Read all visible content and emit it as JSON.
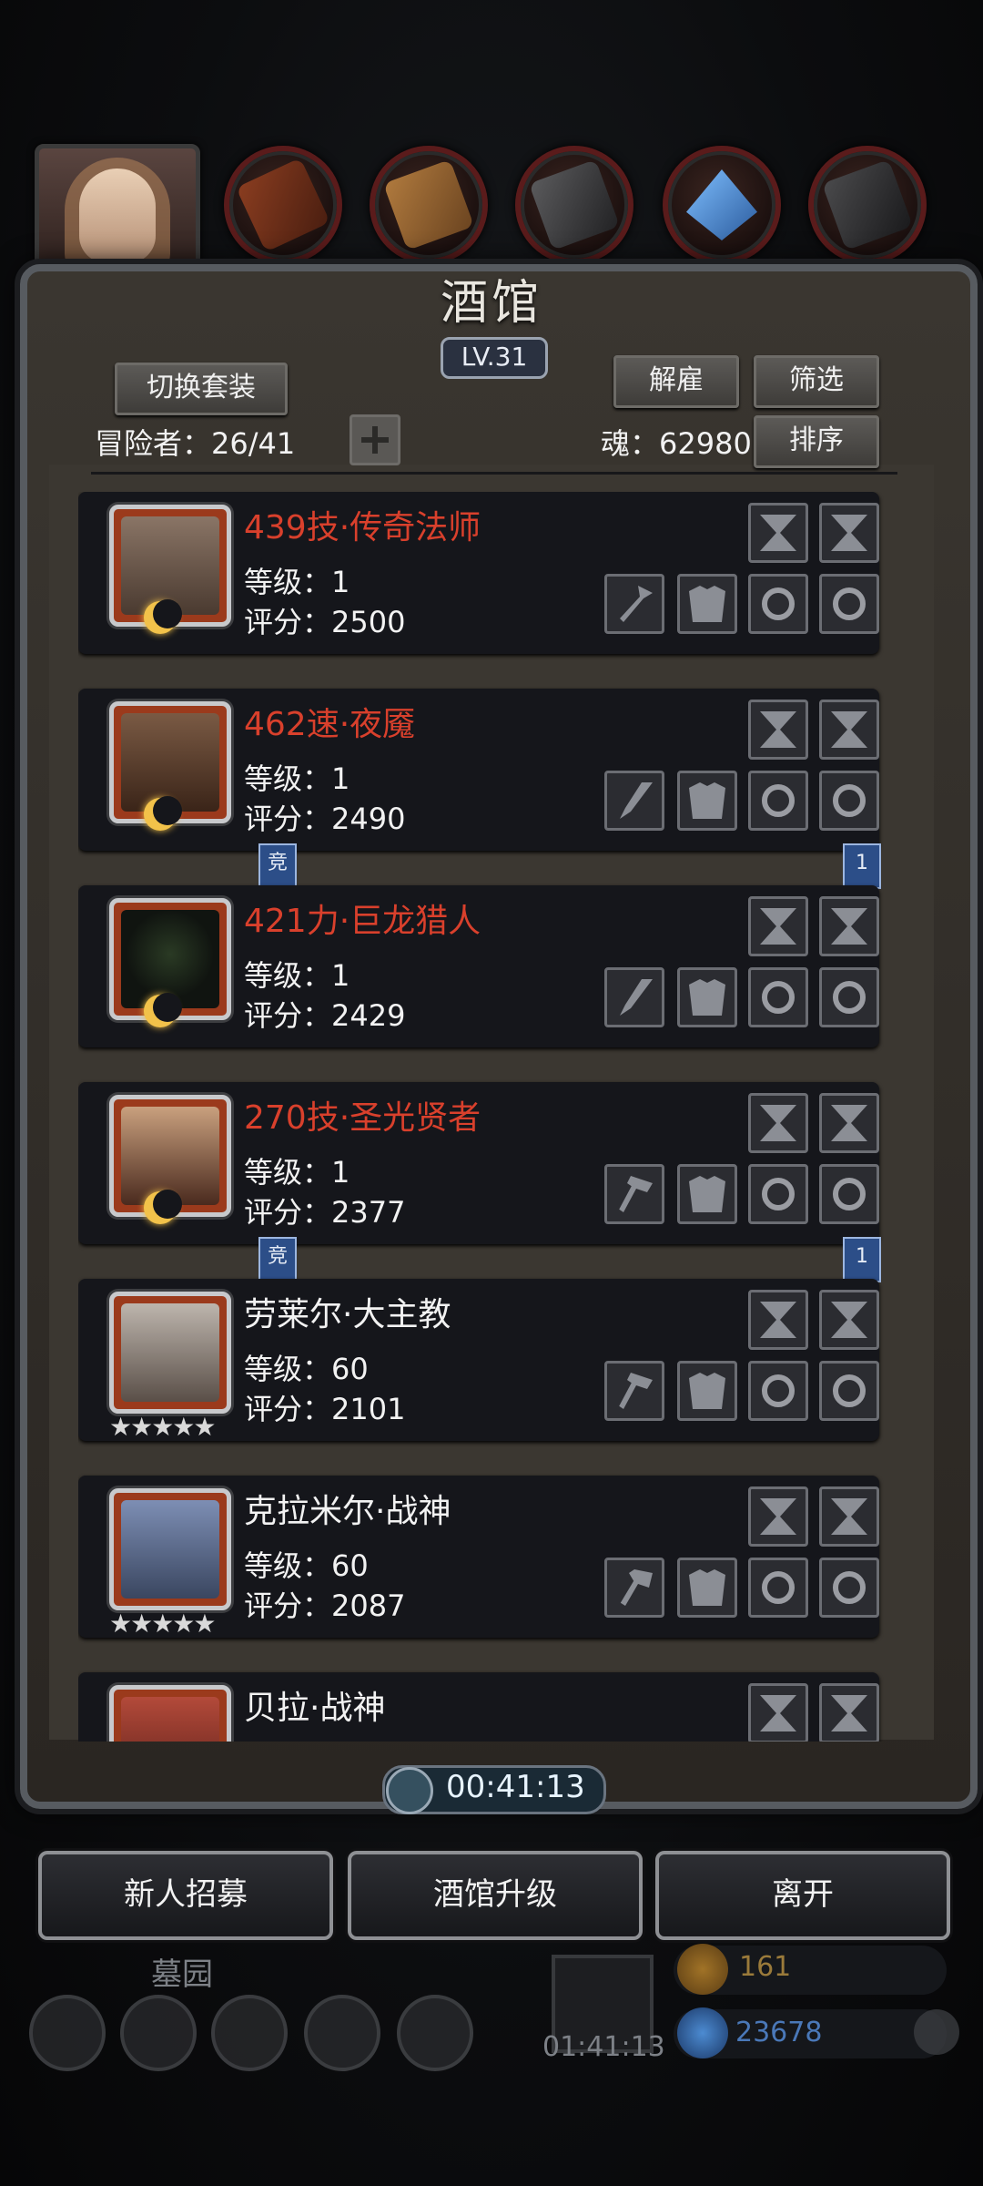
{
  "tavern": {
    "title": "酒馆",
    "level": "LV.31",
    "switch_outfit_label": "切换套装",
    "dismiss_label": "解雇",
    "filter_label": "筛选",
    "sort_label": "排序",
    "adventurers_label": "冒险者：26/41",
    "souls_label": "魂：62980"
  },
  "heroes": [
    {
      "name": "439技·传奇法师",
      "level": "等级：1",
      "score": "评分：2500",
      "rare": true,
      "avatar_color": "#6b5646",
      "weapon": "staff"
    },
    {
      "name": "462速·夜魇",
      "level": "等级：1",
      "score": "评分：2490",
      "rare": true,
      "avatar_color": "#5a3d2e",
      "weapon": "blade",
      "tag_left": "竞",
      "tag_right": "1"
    },
    {
      "name": "421力·巨龙猎人",
      "level": "等级：1",
      "score": "评分：2429",
      "rare": true,
      "avatar_color": "#1c2419",
      "weapon": "blade"
    },
    {
      "name": "270技·圣光贤者",
      "level": "等级：1",
      "score": "评分：2377",
      "rare": true,
      "avatar_color": "#6a5040",
      "weapon": "hammer",
      "tag_left": "竞",
      "tag_right": "1"
    },
    {
      "name": "劳莱尔·大主教",
      "level": "等级：60",
      "score": "评分：2101",
      "rare": false,
      "avatar_color": "#8a7d72",
      "weapon": "hammer",
      "stars": "★★★★★"
    },
    {
      "name": "克拉米尔·战神",
      "level": "等级：60",
      "score": "评分：2087",
      "rare": false,
      "avatar_color": "#5b6a8c",
      "weapon": "axe",
      "stars": "★★★★★"
    },
    {
      "name": "贝拉·战神",
      "rare": false,
      "avatar_color": "#9b3a2a"
    }
  ],
  "timer": "00:41:13",
  "bottom_buttons": {
    "recruit": "新人招募",
    "upgrade": "酒馆升级",
    "leave": "离开"
  },
  "background": {
    "graveyard": "墓园",
    "gift_timer": "01:41:13",
    "gold": "161",
    "gems": "23678"
  },
  "colors": {
    "rare_name": "#d9402c",
    "frame": "#575b60",
    "timer_text": "#e8f4ff"
  }
}
